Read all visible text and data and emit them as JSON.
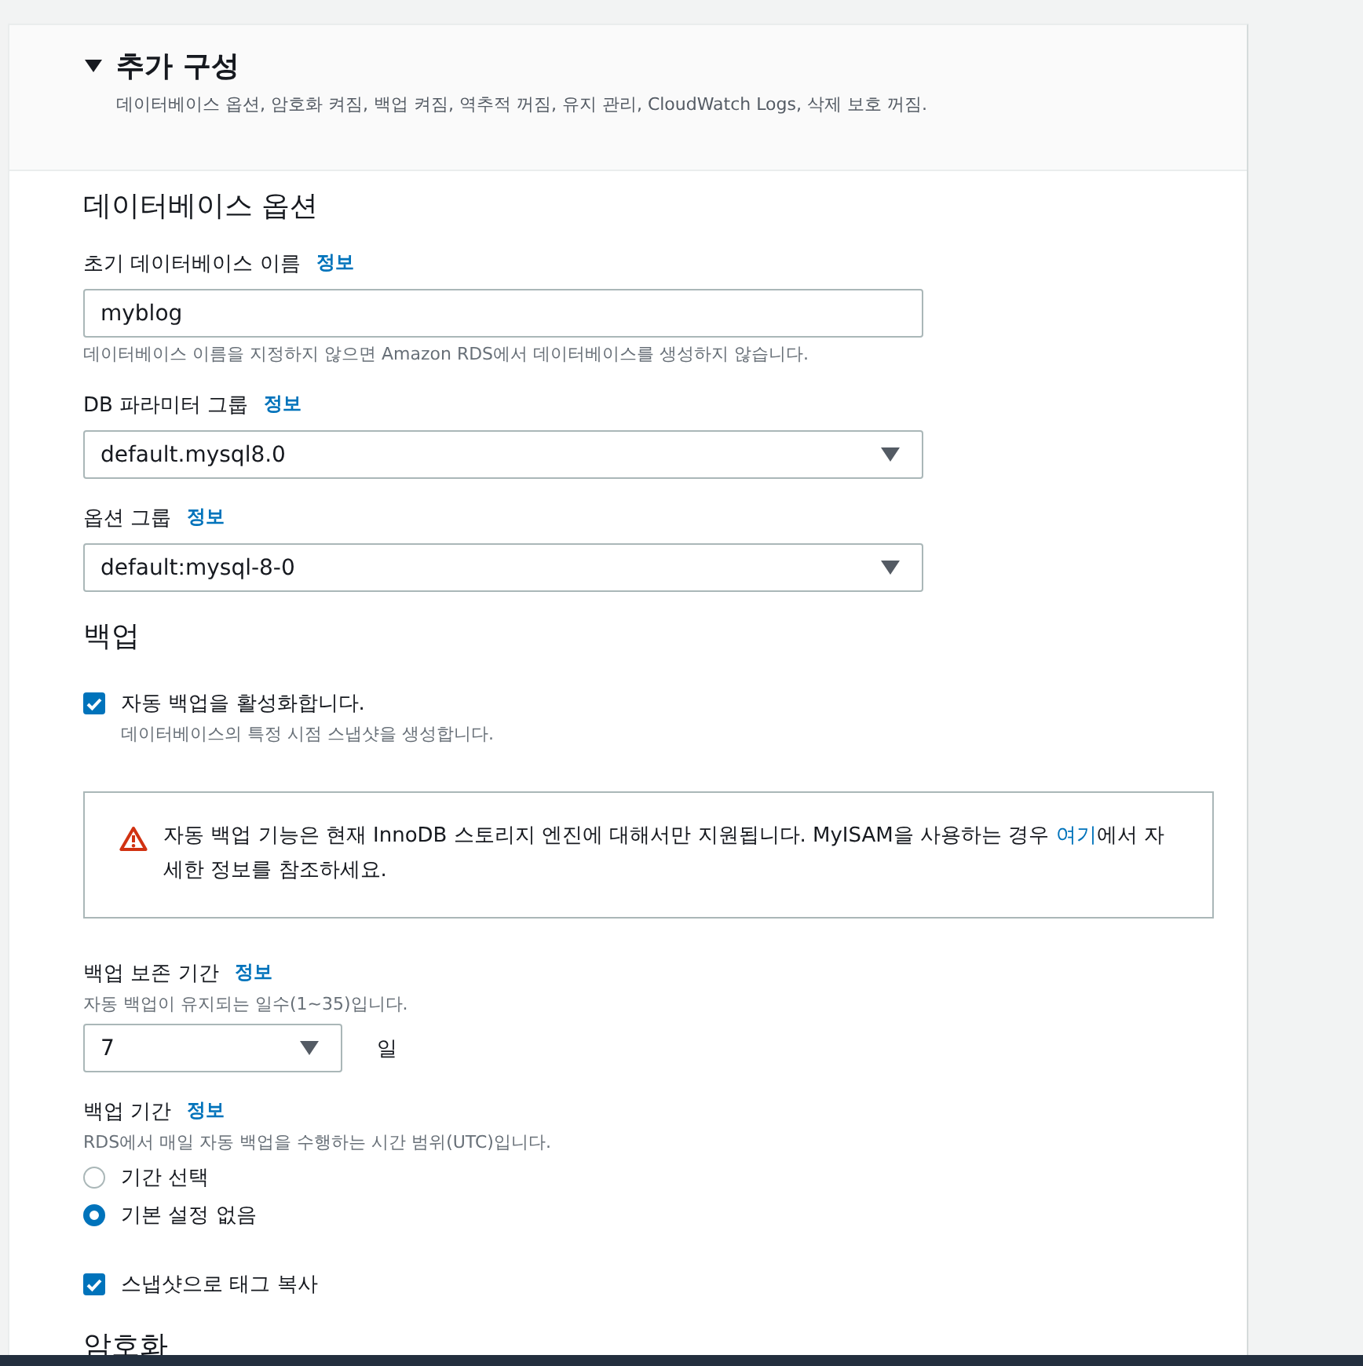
{
  "section": {
    "title": "추가 구성",
    "expanded": true,
    "summary": "데이터베이스 옵션, 암호화 켜짐, 백업 켜짐, 역추적 꺼짐, 유지 관리, CloudWatch Logs, 삭제 보호 꺼짐."
  },
  "database_options": {
    "heading": "데이터베이스 옵션",
    "fields": [
      {
        "kind": "input",
        "label": "초기 데이터베이스 이름",
        "info": "정보",
        "value": "myblog",
        "hint": "데이터베이스 이름을 지정하지 않으면 Amazon RDS에서 데이터베이스를 생성하지 않습니다."
      },
      {
        "kind": "select",
        "label": "DB 파라미터 그룹",
        "info": "정보",
        "value": "default.mysql8.0"
      },
      {
        "kind": "select",
        "label": "옵션 그룹",
        "info": "정보",
        "value": "default:mysql-8-0"
      }
    ]
  },
  "backup": {
    "heading": "백업",
    "enable": {
      "label": "자동 백업을 활성화합니다.",
      "description": "데이터베이스의 특정 시점 스냅샷을 생성합니다.",
      "checked": true
    },
    "warning": {
      "text_before": "자동 백업 기능은 현재 InnoDB 스토리지 엔진에 대해서만 지원됩니다. MyISAM을 사용하는 경우 ",
      "link": "여기",
      "text_after": "에서 자세한 정보를 참조하세요."
    },
    "retention": {
      "label": "백업 보존 기간",
      "info": "정보",
      "description": "자동 백업이 유지되는 일수(1~35)입니다.",
      "value": "7",
      "unit": "일"
    },
    "window": {
      "label": "백업 기간",
      "info": "정보",
      "description": "RDS에서 매일 자동 백업을 수행하는 시간 범위(UTC)입니다.",
      "options": [
        {
          "label": "기간 선택",
          "selected": false
        },
        {
          "label": "기본 설정 없음",
          "selected": true
        }
      ]
    },
    "copy_tags": {
      "label": "스냅샷으로 태그 복사",
      "checked": true
    }
  },
  "next_heading": "암호화"
}
